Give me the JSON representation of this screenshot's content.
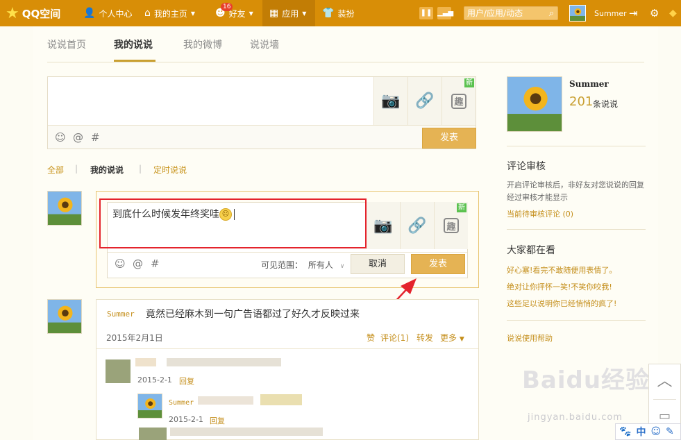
{
  "topbar": {
    "logo": "QQ空间",
    "nav": [
      "个人中心",
      "我的主页",
      "好友",
      "应用",
      "装扮"
    ],
    "friend_badge": "16",
    "search_placeholder": "用户/应用/动态",
    "username": "Summer"
  },
  "tabs": [
    "说说首页",
    "我的说说",
    "我的微博",
    "说说墙"
  ],
  "composer": {
    "publish": "发表",
    "new_badge": "新",
    "qu": "趣"
  },
  "filters": [
    "全部",
    "我的说说",
    "定时说说"
  ],
  "reply_editor": {
    "text": "到底什么时候发年终奖哇",
    "visibility_label": "可见范围：",
    "visibility_value": "所有人",
    "cancel": "取消",
    "publish": "发表"
  },
  "post": {
    "author": "Summer",
    "content": "竟然已经麻木到一句广告语都过了好久才反映过来",
    "date": "2015年2月1日",
    "actions": [
      "赞",
      "评论(1)",
      "转发",
      "更多"
    ],
    "comments": [
      {
        "date": "2015-2-1",
        "reply": "回复"
      },
      {
        "name": "Summer",
        "date": "2015-2-1",
        "reply": "回复"
      }
    ]
  },
  "sidebar": {
    "name": "Summer",
    "count": "201",
    "count_label": "条说说",
    "review_title": "评论审核",
    "review_desc": "开启评论审核后，非好友对您说说的回复经过审核才能显示",
    "review_link": "当前待审核评论 (0)",
    "trending_title": "大家都在看",
    "trending": [
      "好心塞!看完不敢随便用表情了。",
      "绝对让你抨怀一笑!不笑你咬我!",
      "这些足以说明你已经悄悄的疯了!"
    ],
    "help": "说说使用帮助"
  },
  "watermark": {
    "brand": "Baidu经验",
    "url": "jingyan.baidu.com",
    "bar_label": "中"
  }
}
